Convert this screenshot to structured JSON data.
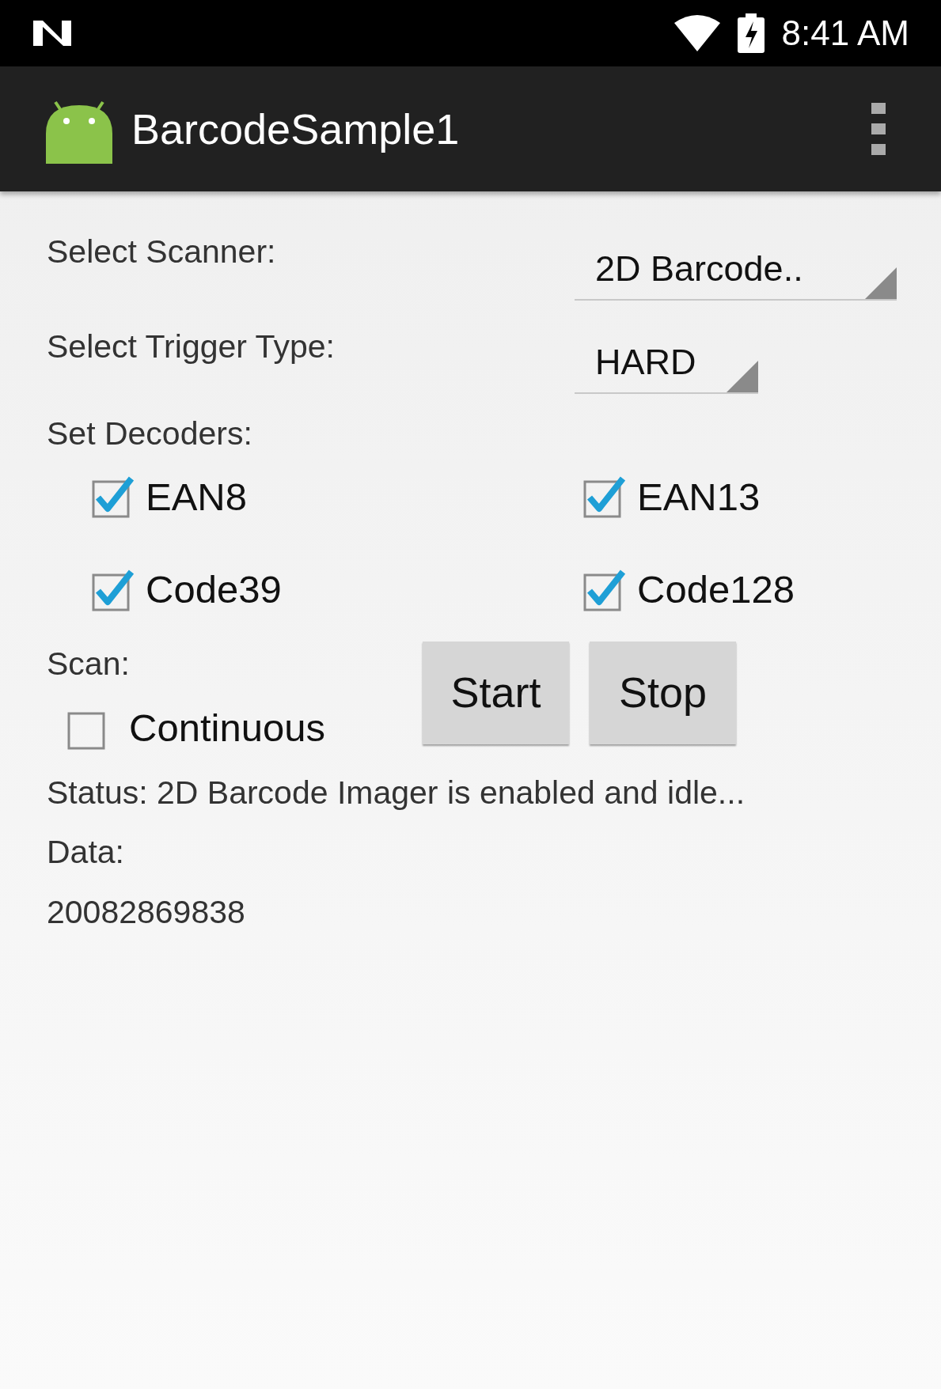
{
  "status_bar": {
    "time": "8:41 AM"
  },
  "app_bar": {
    "title": "BarcodeSample1"
  },
  "form": {
    "scanner": {
      "label": "Select Scanner:",
      "value": "2D Barcode.."
    },
    "trigger": {
      "label": "Select Trigger Type:",
      "value": "HARD"
    },
    "decoders_label": "Set Decoders:",
    "decoders": [
      {
        "label": "EAN8",
        "checked": true
      },
      {
        "label": "EAN13",
        "checked": true
      },
      {
        "label": "Code39",
        "checked": true
      },
      {
        "label": "Code128",
        "checked": true
      }
    ],
    "scan_label": "Scan:",
    "continuous": {
      "label": "Continuous",
      "checked": false
    },
    "buttons": [
      "Start",
      "Stop"
    ],
    "status": "Status: 2D Barcode Imager is enabled and idle...",
    "data_label": "Data:",
    "data_value": "20082869838"
  }
}
